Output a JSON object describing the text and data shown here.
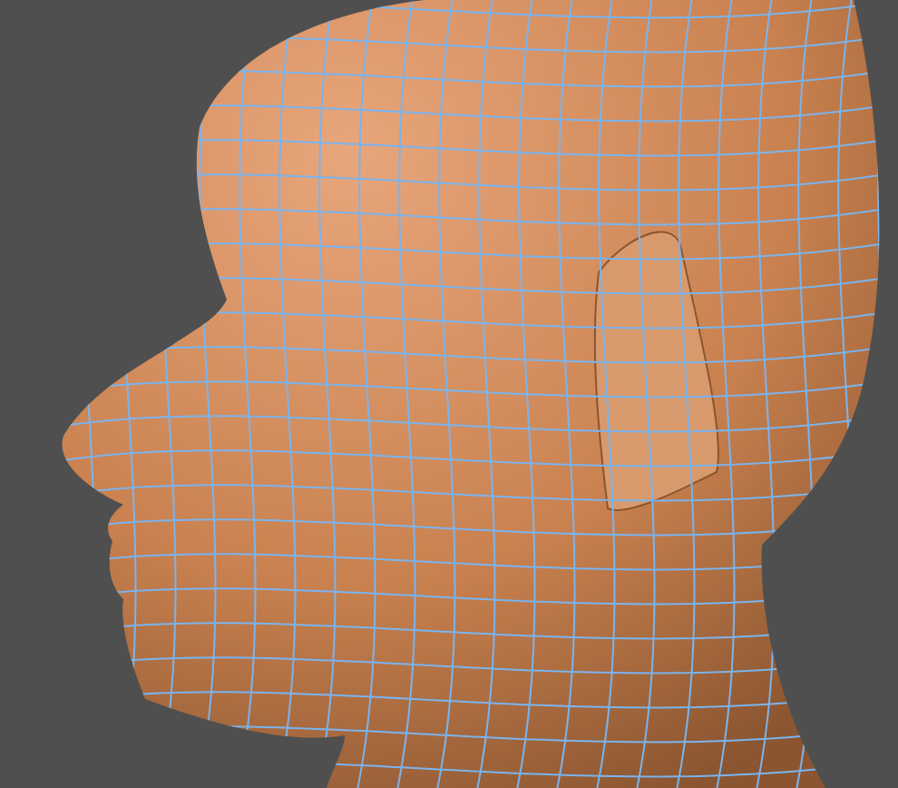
{
  "viewport": {
    "shaded": true,
    "wireframe": true
  }
}
